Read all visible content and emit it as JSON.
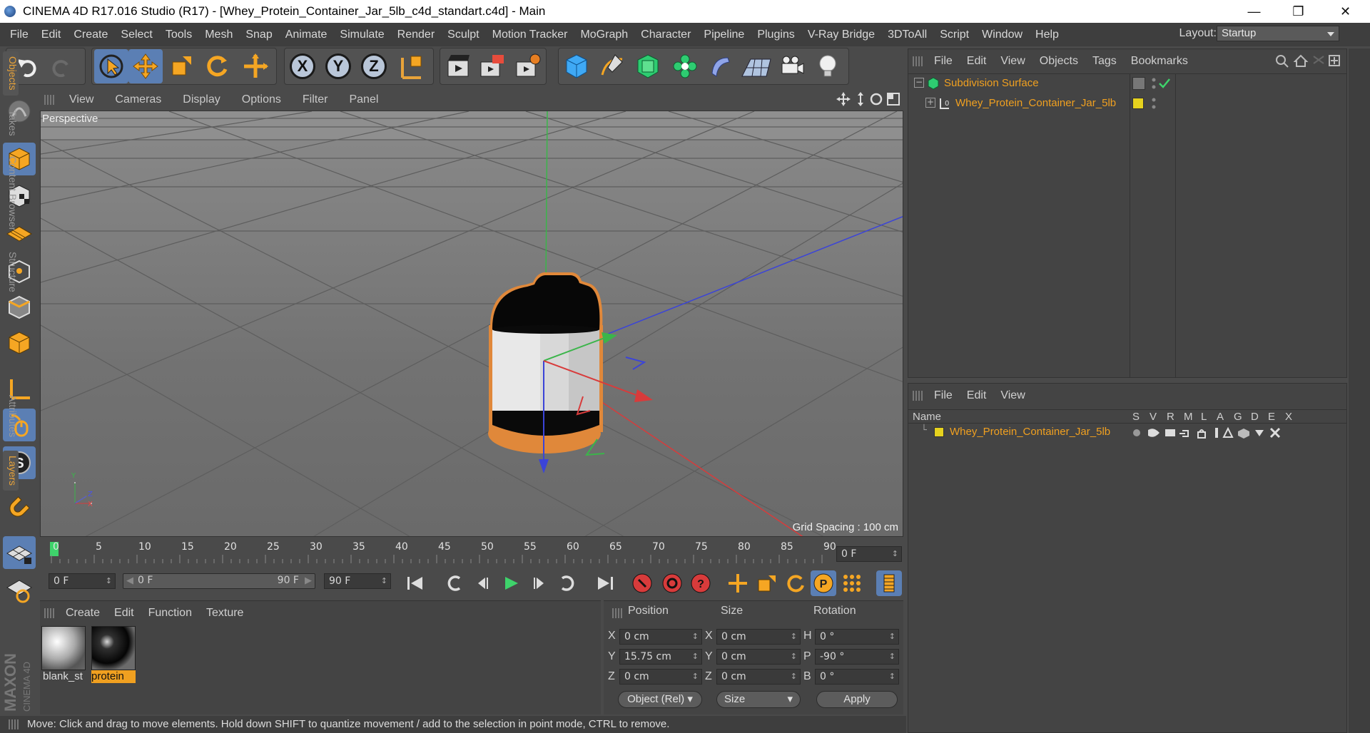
{
  "window": {
    "title": "CINEMA 4D R17.016 Studio (R17) - [Whey_Protein_Container_Jar_5lb_c4d_standart.c4d] - Main",
    "minimize": "—",
    "maximize": "❐",
    "close": "✕"
  },
  "menu": [
    "File",
    "Edit",
    "Create",
    "Select",
    "Tools",
    "Mesh",
    "Snap",
    "Animate",
    "Simulate",
    "Render",
    "Sculpt",
    "Motion Tracker",
    "MoGraph",
    "Character",
    "Pipeline",
    "Plugins",
    "V-Ray Bridge",
    "3DToAll",
    "Script",
    "Window",
    "Help"
  ],
  "layout": {
    "label": "Layout:",
    "value": "Startup"
  },
  "toolbar": {
    "axes": [
      "X",
      "Y",
      "Z"
    ]
  },
  "viewport": {
    "menu": [
      "View",
      "Cameras",
      "Display",
      "Options",
      "Filter",
      "Panel"
    ],
    "name": "Perspective",
    "grid_spacing": "Grid Spacing : 100 cm",
    "gizmo_y": "Y",
    "gizmo_z": "Z",
    "gizmo_x": "X"
  },
  "timeline": {
    "ticks": [
      "0",
      "5",
      "10",
      "15",
      "20",
      "25",
      "30",
      "35",
      "40",
      "45",
      "50",
      "55",
      "60",
      "65",
      "70",
      "75",
      "80",
      "85",
      "90"
    ],
    "current_frame": "0 F",
    "start_field": "0 F",
    "range_start": "0 F",
    "range_end": "90 F",
    "end_field": "90 F"
  },
  "materials": {
    "menu": [
      "Create",
      "Edit",
      "Function",
      "Texture"
    ],
    "items": [
      {
        "label": "blank_st"
      },
      {
        "label": "protein"
      }
    ]
  },
  "coordinates": {
    "headers": [
      "Position",
      "Size",
      "Rotation"
    ],
    "pos": [
      {
        "axis": "X",
        "value": "0 cm"
      },
      {
        "axis": "Y",
        "value": "15.75 cm"
      },
      {
        "axis": "Z",
        "value": "0 cm"
      }
    ],
    "size": [
      {
        "axis": "X",
        "value": "0 cm"
      },
      {
        "axis": "Y",
        "value": "0 cm"
      },
      {
        "axis": "Z",
        "value": "0 cm"
      }
    ],
    "rot": [
      {
        "axis": "H",
        "value": "0 °"
      },
      {
        "axis": "P",
        "value": "-90 °"
      },
      {
        "axis": "B",
        "value": "0 °"
      }
    ],
    "mode": "Object (Rel)",
    "size_mode": "Size",
    "apply": "Apply"
  },
  "status": "Move: Click and drag to move elements. Hold down SHIFT to quantize movement / add to the selection in point mode, CTRL to remove.",
  "objects": {
    "menu": [
      "File",
      "Edit",
      "View",
      "Objects",
      "Tags",
      "Bookmarks"
    ],
    "items": [
      {
        "name": "Subdivision Surface"
      },
      {
        "name": "Whey_Protein_Container_Jar_5lb"
      }
    ]
  },
  "layers": {
    "menu": [
      "File",
      "Edit",
      "View"
    ],
    "name_header": "Name",
    "cols": [
      "S",
      "V",
      "R",
      "M",
      "L",
      "A",
      "G",
      "D",
      "E",
      "X"
    ],
    "row": "Whey_Protein_Container_Jar_5lb"
  },
  "right_tabs": [
    "Objects",
    "Takes",
    "Content Browser",
    "Structure",
    "Attributes",
    "Layers"
  ],
  "branding": "MAXON CINEMA 4D",
  "colors": {
    "accent_orange": "#f0a020",
    "selected_blue": "#5b7fb4",
    "layer_yellow": "#e6d21e"
  }
}
